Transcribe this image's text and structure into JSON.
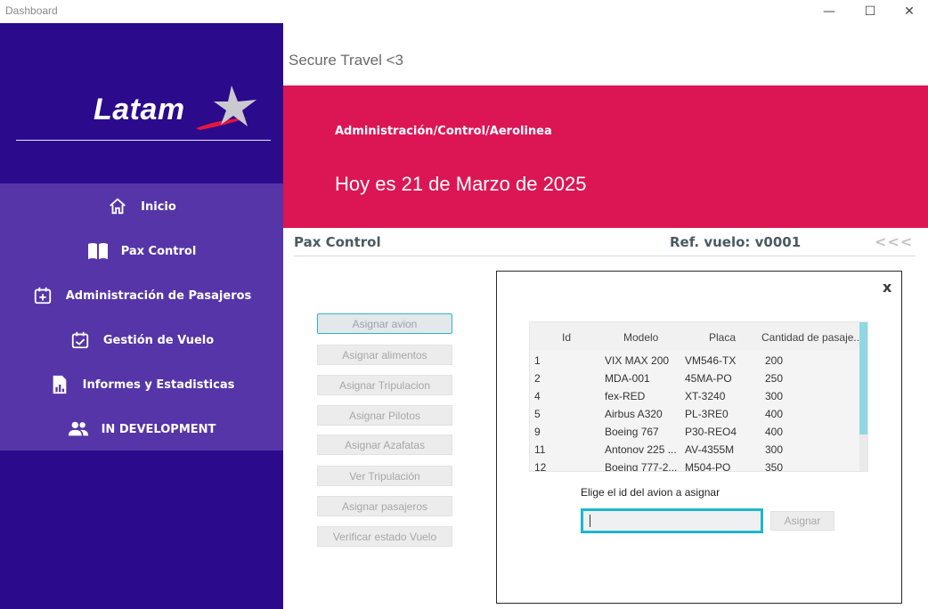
{
  "window": {
    "title": "Dashboard",
    "controls": {
      "minimize": "—",
      "maximize": "☐",
      "close": "✕"
    }
  },
  "sidebar": {
    "logo": {
      "text": "Latam"
    },
    "items": [
      {
        "label": "Inicio",
        "icon": "home-icon"
      },
      {
        "label": "Pax Control",
        "icon": "book-open-icon"
      },
      {
        "label": "Administración de Pasajeros",
        "icon": "calendar-plus-icon"
      },
      {
        "label": "Gestión de Vuelo",
        "icon": "calendar-check-icon"
      },
      {
        "label": "Informes y Estadisticas",
        "icon": "report-chart-icon"
      },
      {
        "label": "IN DEVELOPMENT",
        "icon": "people-icon"
      }
    ]
  },
  "header": {
    "subtitle": "Secure Travel <3",
    "banner_path": "Administración/Control/Aerolinea",
    "banner_date": "Hoy es 21 de Marzo de 2025"
  },
  "section": {
    "title": "Pax Control",
    "ref": "Ref. vuelo: v0001",
    "back": "<<<"
  },
  "actions": [
    "Asignar avion",
    "Asignar alimentos",
    "Asignar Tripulacion",
    "Asignar Pilotos",
    "Asignar Azafatas",
    "Ver Tripulación",
    "Asignar pasajeros",
    "Verificar estado Vuelo"
  ],
  "panel": {
    "close": "x",
    "table": {
      "columns": [
        "Id",
        "Modelo",
        "Placa",
        "Cantidad de pasaje..."
      ],
      "rows": [
        [
          "1",
          "VIX MAX 200",
          "VM546-TX",
          "200"
        ],
        [
          "2",
          "MDA-001",
          "45MA-PO",
          "250"
        ],
        [
          "4",
          "fex-RED",
          "XT-3240",
          "300"
        ],
        [
          "5",
          "Airbus A320",
          "PL-3RE0",
          "400"
        ],
        [
          "9",
          "Boeing 767",
          "P30-REO4",
          "400"
        ],
        [
          "11",
          "Antonov 225 ...",
          "AV-4355M",
          "300"
        ],
        [
          "12",
          "Boeing 777-2...",
          "M504-PO",
          "350"
        ]
      ]
    },
    "prompt": "Elige el id del avion a asignar",
    "input_value": "",
    "assign_label": "Asignar"
  },
  "colors": {
    "sidebar": "#2b0a8c",
    "menu": "#5535a8",
    "banner": "#dc1654",
    "accent": "#1fb7ca"
  }
}
